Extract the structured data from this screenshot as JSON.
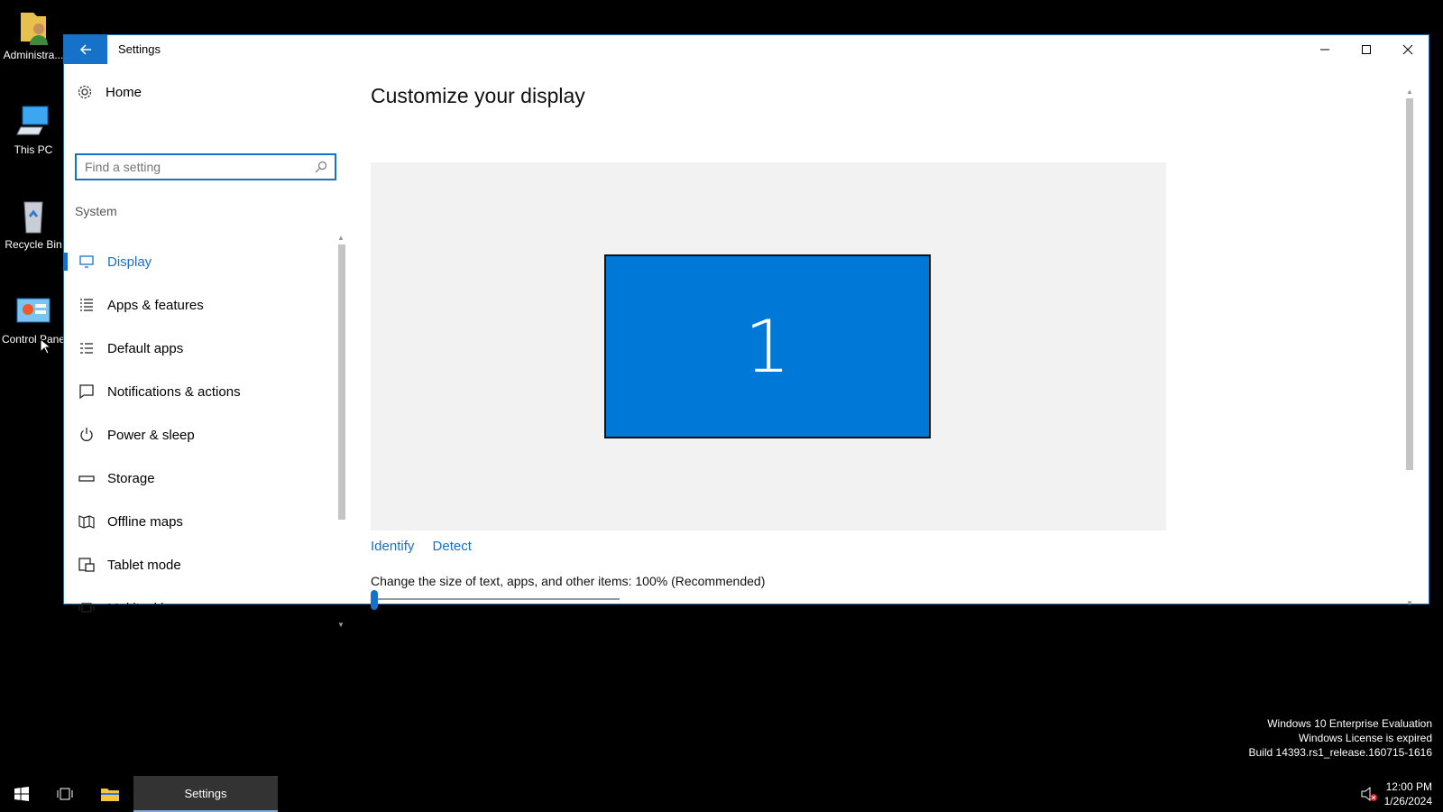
{
  "desktop": {
    "icons": [
      {
        "label": "Administra...",
        "icon": "user-folder-icon"
      },
      {
        "label": "This PC",
        "icon": "computer-icon"
      },
      {
        "label": "Recycle Bin",
        "icon": "recycle-bin-icon"
      },
      {
        "label": "Control Pane",
        "icon": "control-panel-icon"
      }
    ]
  },
  "window": {
    "title": "Settings",
    "controls": {
      "minimize": "minimize-icon",
      "maximize": "maximize-icon",
      "close": "close-icon"
    }
  },
  "sidebar": {
    "home_label": "Home",
    "search_placeholder": "Find a setting",
    "section_label": "System",
    "items": [
      {
        "label": "Display",
        "icon": "display-icon",
        "active": true
      },
      {
        "label": "Apps & features",
        "icon": "apps-list-icon"
      },
      {
        "label": "Default apps",
        "icon": "default-apps-icon"
      },
      {
        "label": "Notifications & actions",
        "icon": "notifications-icon"
      },
      {
        "label": "Power & sleep",
        "icon": "power-icon"
      },
      {
        "label": "Storage",
        "icon": "storage-icon"
      },
      {
        "label": "Offline maps",
        "icon": "map-icon"
      },
      {
        "label": "Tablet mode",
        "icon": "tablet-mode-icon"
      },
      {
        "label": "Multitasking",
        "icon": "multitasking-icon"
      }
    ]
  },
  "main": {
    "heading": "Customize your display",
    "monitor_number": "1",
    "identify_label": "Identify",
    "detect_label": "Detect",
    "scale_label": "Change the size of text, apps, and other items: 100% (Recommended)",
    "scale_value": 0
  },
  "watermark": {
    "line1": "Windows 10 Enterprise Evaluation",
    "line2": "Windows License is expired",
    "line3": "Build 14393.rs1_release.160715-1616"
  },
  "taskbar": {
    "settings_label": "Settings",
    "time": "12:00 PM",
    "date": "1/26/2024"
  },
  "colors": {
    "accent": "#1572c8",
    "monitor": "#0078d7",
    "desktop": "#000000"
  }
}
